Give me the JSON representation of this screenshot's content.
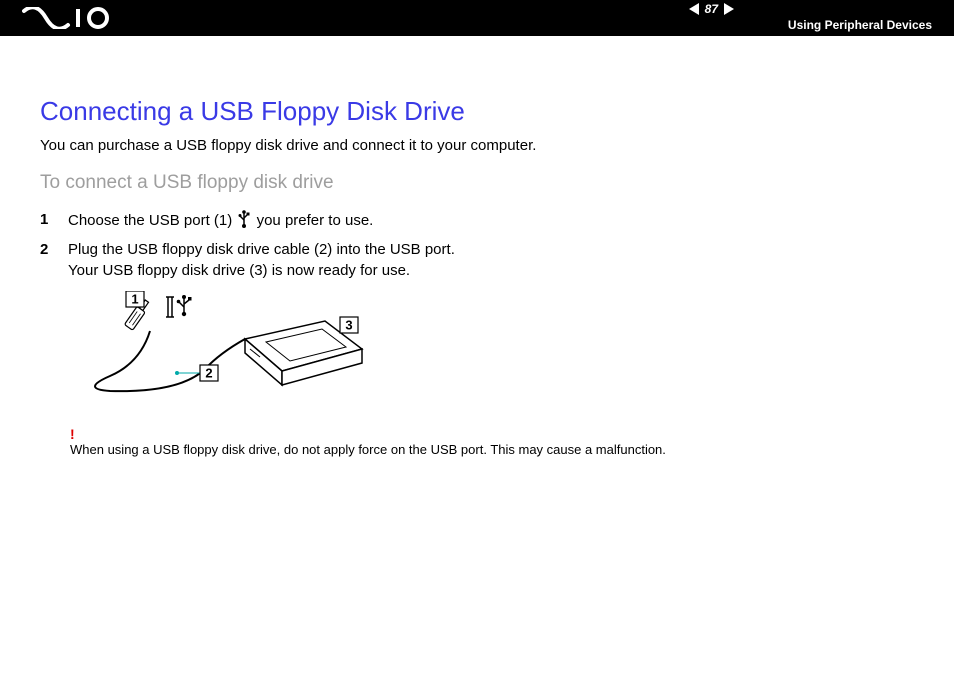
{
  "header": {
    "page_number": "87",
    "section": "Using Peripheral Devices"
  },
  "title": "Connecting a USB Floppy Disk Drive",
  "intro": "You can purchase a USB floppy disk drive and connect it to your computer.",
  "subtitle": "To connect a USB floppy disk drive",
  "steps": {
    "s1_a": "Choose the USB port (1) ",
    "s1_b": " you prefer to use.",
    "s2_a": "Plug the USB floppy disk drive cable (2) into the USB port.",
    "s2_b": "Your USB floppy disk drive (3) is now ready for use."
  },
  "diagram": {
    "label1": "1",
    "label2": "2",
    "label3": "3"
  },
  "warning": {
    "mark": "!",
    "text": "When using a USB floppy disk drive, do not apply force on the USB port. This may cause a malfunction."
  }
}
